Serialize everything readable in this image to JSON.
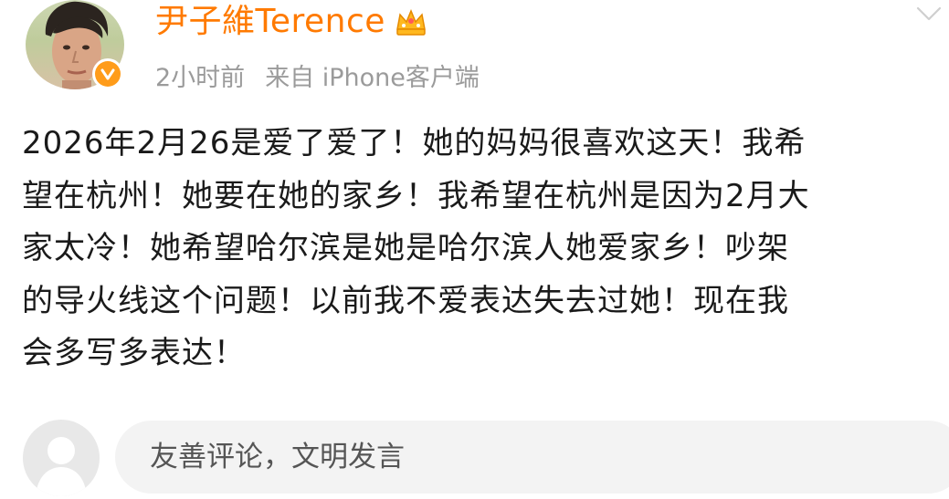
{
  "post": {
    "author": {
      "name": "尹子維Terence",
      "avatar_icon": "profile-photo",
      "verified_icon": "verified-check-icon",
      "member_icon": "crown-icon"
    },
    "time": "2小时前",
    "source": "来自 iPhone客户端",
    "text": "2026年2月26是爱了爱了！她的妈妈很喜欢这天！我希\n望在杭州！她要在她的家乡！我希望在杭州是因为2月大\n家太冷！她希望哈尔滨是她是哈尔滨人她爱家乡！吵架\n的导火线这个问题！以前我不爱表达失去过她！现在我\n会多写多表达！"
  },
  "comment": {
    "placeholder": "友善评论，文明发言"
  },
  "colors": {
    "username": "#ff7a00",
    "verified": "#ff9c1a",
    "meta": "#9b9b9b",
    "text": "#1a1a1a",
    "input_bg": "#f3f3f3"
  }
}
